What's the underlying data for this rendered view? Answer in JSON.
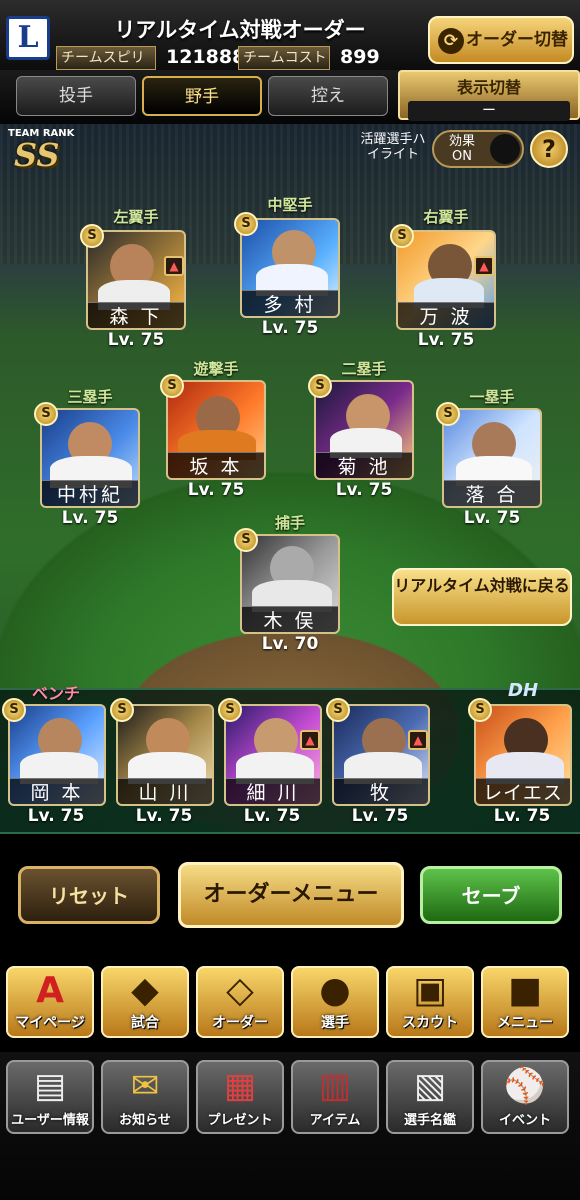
{
  "header": {
    "title": "リアルタイム対戦オーダー",
    "spirit_label": "チームスピリッツ",
    "spirit_value": "121888",
    "cost_label": "チームコスト",
    "cost_value": "899",
    "order_switch": "オーダー切替",
    "logo_letter": "L"
  },
  "tabs": [
    {
      "label": "投手"
    },
    {
      "label": "野手"
    },
    {
      "label": "控え"
    }
  ],
  "display_switch": {
    "label": "表示切替",
    "value": "ー"
  },
  "team_rank": {
    "label": "TEAM RANK",
    "value": "SS"
  },
  "highlight_label": "活躍選手ハイライト",
  "effect": {
    "label": "効果",
    "state": "ON"
  },
  "help_icon": "?",
  "positions": {
    "lf": "左翼手",
    "cf": "中堅手",
    "rf": "右翼手",
    "ss": "遊撃手",
    "b2": "二塁手",
    "b3": "三塁手",
    "b1": "一塁手",
    "c": "捕手"
  },
  "fielders": [
    {
      "name": "森 下",
      "level": "Lv. 75"
    },
    {
      "name": "多 村",
      "level": "Lv. 75"
    },
    {
      "name": "万 波",
      "level": "Lv. 75"
    },
    {
      "name": "坂 本",
      "level": "Lv. 75"
    },
    {
      "name": "菊 池",
      "level": "Lv. 75"
    },
    {
      "name": "中村紀",
      "level": "Lv. 75"
    },
    {
      "name": "落 合",
      "level": "Lv. 75"
    },
    {
      "name": "木 俣",
      "level": "Lv. 70"
    }
  ],
  "badge_letter": "S",
  "realtime_button": "リアルタイム対戦に戻る",
  "bench_label": "ベンチ",
  "dh_label": "DH",
  "bench": [
    {
      "name": "岡 本",
      "level": "Lv. 75"
    },
    {
      "name": "山 川",
      "level": "Lv. 75"
    },
    {
      "name": "細 川",
      "level": "Lv. 75"
    },
    {
      "name": "牧",
      "level": "Lv. 75"
    },
    {
      "name": "レイエス",
      "level": "Lv. 75"
    }
  ],
  "buttons": {
    "reset": "リセット",
    "order_menu": "オーダーメニュー",
    "save": "セーブ"
  },
  "nav_main": [
    {
      "label": "マイページ",
      "icon": "A"
    },
    {
      "label": "試合",
      "icon": "◆"
    },
    {
      "label": "オーダー",
      "icon": "◇"
    },
    {
      "label": "選手",
      "icon": "●"
    },
    {
      "label": "スカウト",
      "icon": "▣"
    },
    {
      "label": "メニュー",
      "icon": "■"
    }
  ],
  "nav_sub": [
    {
      "label": "ユーザー情報",
      "icon": "▤"
    },
    {
      "label": "お知らせ",
      "icon": "✉"
    },
    {
      "label": "プレゼント",
      "icon": "▦"
    },
    {
      "label": "アイテム",
      "icon": "▥"
    },
    {
      "label": "選手名鑑",
      "icon": "▧"
    },
    {
      "label": "イベント",
      "icon": "⚾"
    }
  ]
}
